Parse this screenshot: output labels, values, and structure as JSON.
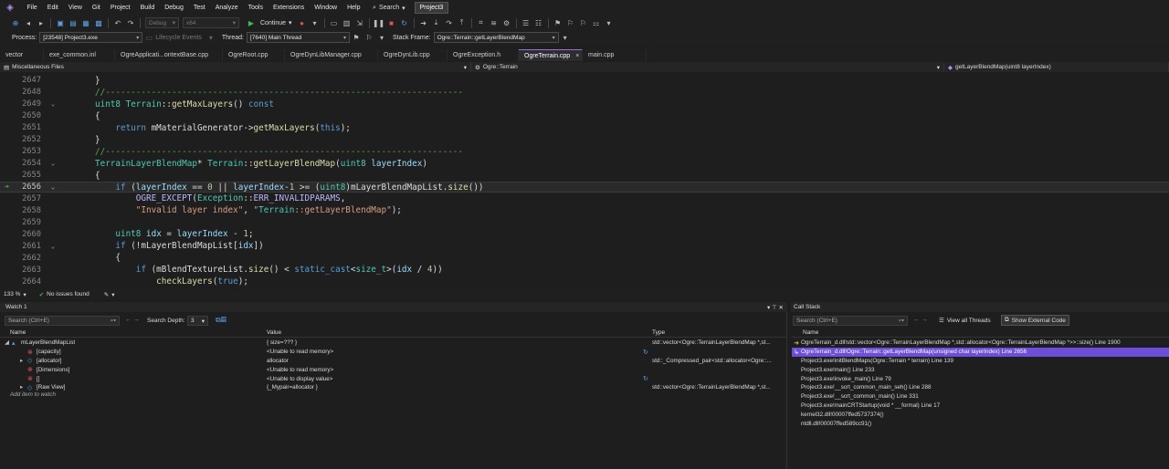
{
  "menu": [
    "File",
    "Edit",
    "View",
    "Git",
    "Project",
    "Build",
    "Debug",
    "Test",
    "Analyze",
    "Tools",
    "Extensions",
    "Window",
    "Help"
  ],
  "search_label": "Search",
  "project_badge": "Project3",
  "toolbar1": {
    "config": "Debug",
    "platform": "x64",
    "continue": "Continue"
  },
  "toolbar2": {
    "process_label": "Process:",
    "process": "[23548] Project3.exe",
    "lifecycle": "Lifecycle Events",
    "thread_label": "Thread:",
    "thread": "[7640] Main Thread",
    "stackframe_label": "Stack Frame:",
    "stackframe": "Ogre::Terrain::getLayerBlendMap"
  },
  "tabs": [
    {
      "label": "vector"
    },
    {
      "label": "exe_common.inl"
    },
    {
      "label": "OgreApplicati...ontextBase.cpp"
    },
    {
      "label": "OgreRoot.cpp"
    },
    {
      "label": "OgreDynLibManager.cpp"
    },
    {
      "label": "OgreDynLib.cpp"
    },
    {
      "label": "OgreException.h"
    },
    {
      "label": "OgreTerrain.cpp",
      "active": true,
      "close": "×"
    },
    {
      "label": "main.cpp"
    }
  ],
  "navbar": {
    "project": "Miscellaneous Files",
    "scope": "Ogre::Terrain",
    "member": "getLayerBlendMap(uint8 layerIndex)"
  },
  "code_lines": [
    {
      "n": "2647",
      "t": "}"
    },
    {
      "n": "2648",
      "t": "//----------------------------------------------------------------------"
    },
    {
      "n": "2649",
      "t": "uint8 Terrain::getMaxLayers() const"
    },
    {
      "n": "2650",
      "t": "{"
    },
    {
      "n": "2651",
      "t": "    return mMaterialGenerator->getMaxLayers(this);"
    },
    {
      "n": "2652",
      "t": "}"
    },
    {
      "n": "2653",
      "t": "//----------------------------------------------------------------------"
    },
    {
      "n": "2654",
      "t": "TerrainLayerBlendMap* Terrain::getLayerBlendMap(uint8 layerIndex)"
    },
    {
      "n": "2655",
      "t": "{"
    },
    {
      "n": "2656",
      "t": "    if (layerIndex == 0 || layerIndex-1 >= (uint8)mLayerBlendMapList.size())"
    },
    {
      "n": "2657",
      "t": "        OGRE_EXCEPT(Exception::ERR_INVALIDPARAMS,"
    },
    {
      "n": "2658",
      "t": "        \"Invalid layer index\", \"Terrain::getLayerBlendMap\");"
    },
    {
      "n": "2659",
      "t": ""
    },
    {
      "n": "2660",
      "t": "    uint8 idx = layerIndex - 1;"
    },
    {
      "n": "2661",
      "t": "    if (!mLayerBlendMapList[idx])"
    },
    {
      "n": "2662",
      "t": "    {"
    },
    {
      "n": "2663",
      "t": "        if (mBlendTextureList.size() < static_cast<size_t>(idx / 4))"
    },
    {
      "n": "2664",
      "t": "            checkLayers(true);"
    }
  ],
  "editor_status": {
    "zoom": "133 %",
    "issues": "No issues found"
  },
  "watch": {
    "title": "Watch 1",
    "search_placeholder": "Search (Ctrl+E)",
    "depth_label": "Search Depth:",
    "depth": "3",
    "columns": [
      "Name",
      "Value",
      "Type"
    ],
    "rows": [
      {
        "name": "mLayerBlendMapList",
        "value": "{ size=??? }",
        "type": "std::vector<Ogre::TerrainLayerBlendMap *,st..."
      },
      {
        "name": "[capacity]",
        "value": "<Unable to read memory>",
        "type": ""
      },
      {
        "name": "[allocator]",
        "value": "allocator",
        "type": "std::_Compressed_pair<std::allocator<Ogre::..."
      },
      {
        "name": "[Dimensions]",
        "value": "<Unable to read memory>",
        "type": ""
      },
      {
        "name": "[]",
        "value": "<Unable to display value>",
        "type": ""
      },
      {
        "name": "[Raw View]",
        "value": "{_Mypair=allocator }",
        "type": "std::vector<Ogre::TerrainLayerBlendMap *,st..."
      }
    ],
    "add_item": "Add item to watch"
  },
  "callstack": {
    "title": "Call Stack",
    "search_placeholder": "Search (Ctrl+E)",
    "view_threads": "View all Threads",
    "show_external": "Show External Code",
    "column": "Name",
    "rows": [
      "OgreTerrain_d.dll!std::vector<Ogre::TerrainLayerBlendMap *,std::allocator<Ogre::TerrainLayerBlendMap *>>::size() Line 1900",
      "OgreTerrain_d.dll!Ogre::Terrain::getLayerBlendMap(unsigned char layerIndex) Line 2656",
      "Project3.exe!initBlendMaps(Ogre::Terrain * terrain) Line 139",
      "Project3.exe!main() Line 233",
      "Project3.exe!invoke_main() Line 79",
      "Project3.exe!__scrt_common_main_seh() Line 288",
      "Project3.exe!__scrt_common_main() Line 331",
      "Project3.exe!mainCRTStartup(void * __formal) Line 17",
      "kernel32.dll!00007ffed5737374()",
      "ntdll.dll!00007ffed589cc91()"
    ]
  },
  "colors": {
    "accent": "#9a6fd8",
    "selected": "#6c4ed8",
    "ok": "#3fb950"
  }
}
